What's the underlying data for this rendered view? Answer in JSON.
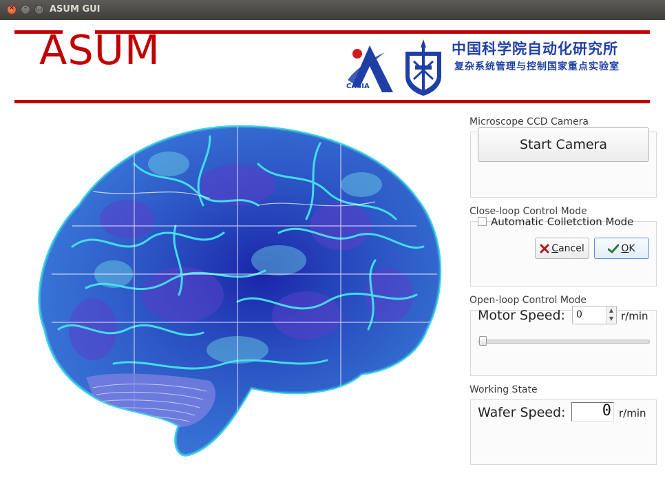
{
  "window": {
    "title": "ASUM GUI",
    "controls": {
      "close": "×",
      "minimize": "–",
      "maximize": "□"
    }
  },
  "header": {
    "app_name": "ASUM",
    "logo_casia_text": "CASIA",
    "institute_cn": "中国科学院自动化研究所",
    "lab_cn": "复杂系统管理与控制国家重点实验室",
    "accent_color": "#c00000",
    "institute_color": "#1f3fa6"
  },
  "camera_section": {
    "label": "Microscope CCD Camera",
    "start_button": "Start Camera"
  },
  "closeloop_section": {
    "label": "Close-loop Control Mode",
    "auto_checkbox_label": "Automatic Colletction Mode",
    "auto_checked": false,
    "cancel_button": {
      "mnemonic": "C",
      "rest": "ancel",
      "icon": "cancel-x-icon"
    },
    "ok_button": {
      "mnemonic": "O",
      "rest": "K",
      "icon": "ok-check-icon"
    }
  },
  "openloop_section": {
    "label": "Open-loop Control Mode",
    "motor_speed_label": "Motor Speed:",
    "motor_speed_value": "0",
    "motor_speed_unit": "r/min",
    "slider_value": 0
  },
  "working_section": {
    "label": "Working State",
    "wafer_speed_label": "Wafer Speed:",
    "wafer_speed_value": "0",
    "wafer_speed_unit": "r/min"
  },
  "illustration": {
    "icon": "brain-illustration"
  }
}
